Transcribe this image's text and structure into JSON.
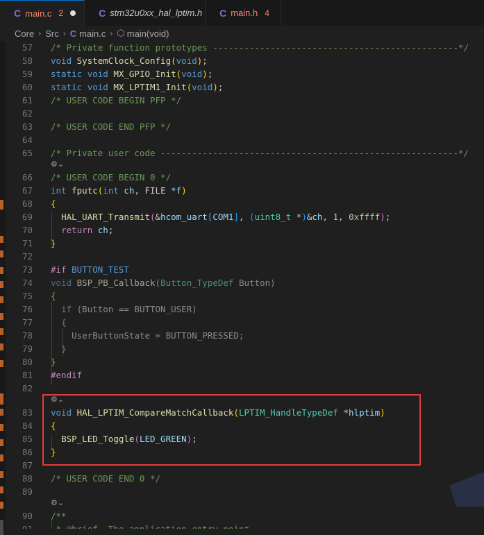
{
  "tabs": [
    {
      "icon": "C",
      "name": "main.c",
      "count": "2",
      "dirty": true,
      "active": true
    },
    {
      "icon": "C",
      "name": "stm32u0xx_hal_lptim.h",
      "count": "",
      "dirty": false,
      "active": false
    },
    {
      "icon": "C",
      "name": "main.h",
      "count": "4",
      "dirty": false,
      "active": false
    }
  ],
  "breadcrumb": {
    "a": "Core",
    "b": "Src",
    "file": "main.c",
    "symbol": "main(void)"
  },
  "codelens": "⛮",
  "lines": {
    "l57": "57",
    "l58": "58",
    "l59": "59",
    "l60": "60",
    "l61": "61",
    "l62": "62",
    "l63": "63",
    "l64": "64",
    "l65": "65",
    "l66": "66",
    "l67": "67",
    "l68": "68",
    "l69": "69",
    "l70": "70",
    "l71": "71",
    "l72": "72",
    "l73": "73",
    "l74": "74",
    "l75": "75",
    "l76": "76",
    "l77": "77",
    "l78": "78",
    "l79": "79",
    "l80": "80",
    "l81": "81",
    "l82": "82",
    "l83": "83",
    "l84": "84",
    "l85": "85",
    "l86": "86",
    "l87": "87",
    "l88": "88",
    "l89": "89",
    "l90": "90",
    "l91": "91"
  },
  "code": {
    "c57": "/* Private function prototypes -----------------------------------------------*/",
    "c61": "/* USER CODE BEGIN PFP */",
    "c63": "/* USER CODE END PFP */",
    "c65": "/* Private user code ---------------------------------------------------------*/",
    "c66": "/* USER CODE BEGIN 0 */",
    "c88": "/* USER CODE END 0 */",
    "c90": "/**",
    "c91": " * @brief  The application entry point."
  }
}
